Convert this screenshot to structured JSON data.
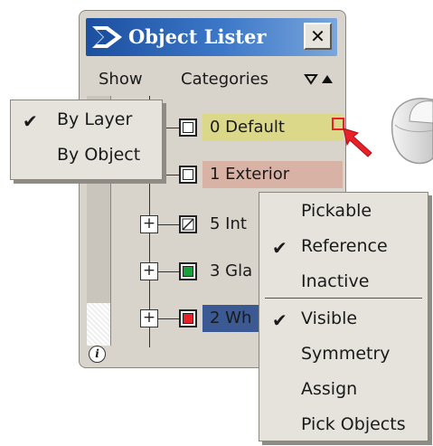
{
  "window": {
    "title": "Object Lister",
    "close_label": "✕"
  },
  "header": {
    "show_label": "Show",
    "categories_label": "Categories"
  },
  "rows": [
    {
      "label": "0 Default",
      "highlight": "#dcd88a",
      "swatch": "#ffffff"
    },
    {
      "label": "1 Exterior",
      "highlight": "#d9b2a6",
      "swatch": "#ffffff"
    },
    {
      "label": "5 Int",
      "highlight": "none",
      "swatch": "hatched"
    },
    {
      "label": "3 Gla",
      "highlight": "none",
      "swatch": "#18a03a"
    },
    {
      "label": "2 Wh",
      "highlight": "#3b5a93",
      "swatch": "#e8202a"
    }
  ],
  "show_menu": {
    "items": [
      {
        "label": "By Layer",
        "checked": true
      },
      {
        "label": "By Object",
        "checked": false
      }
    ]
  },
  "context_menu": {
    "items": [
      {
        "label": "Pickable",
        "checked": false
      },
      {
        "label": "Reference",
        "checked": true
      },
      {
        "label": "Inactive",
        "checked": false
      },
      {
        "label": "Visible",
        "checked": true
      },
      {
        "label": "Symmetry",
        "checked": false
      },
      {
        "label": "Assign",
        "checked": false
      },
      {
        "label": "Pick Objects",
        "checked": false
      }
    ]
  },
  "colors": {
    "titlebar": "#1c4fa0",
    "panel": "#d8d4cc",
    "pointer_arrow": "#e8202a"
  }
}
